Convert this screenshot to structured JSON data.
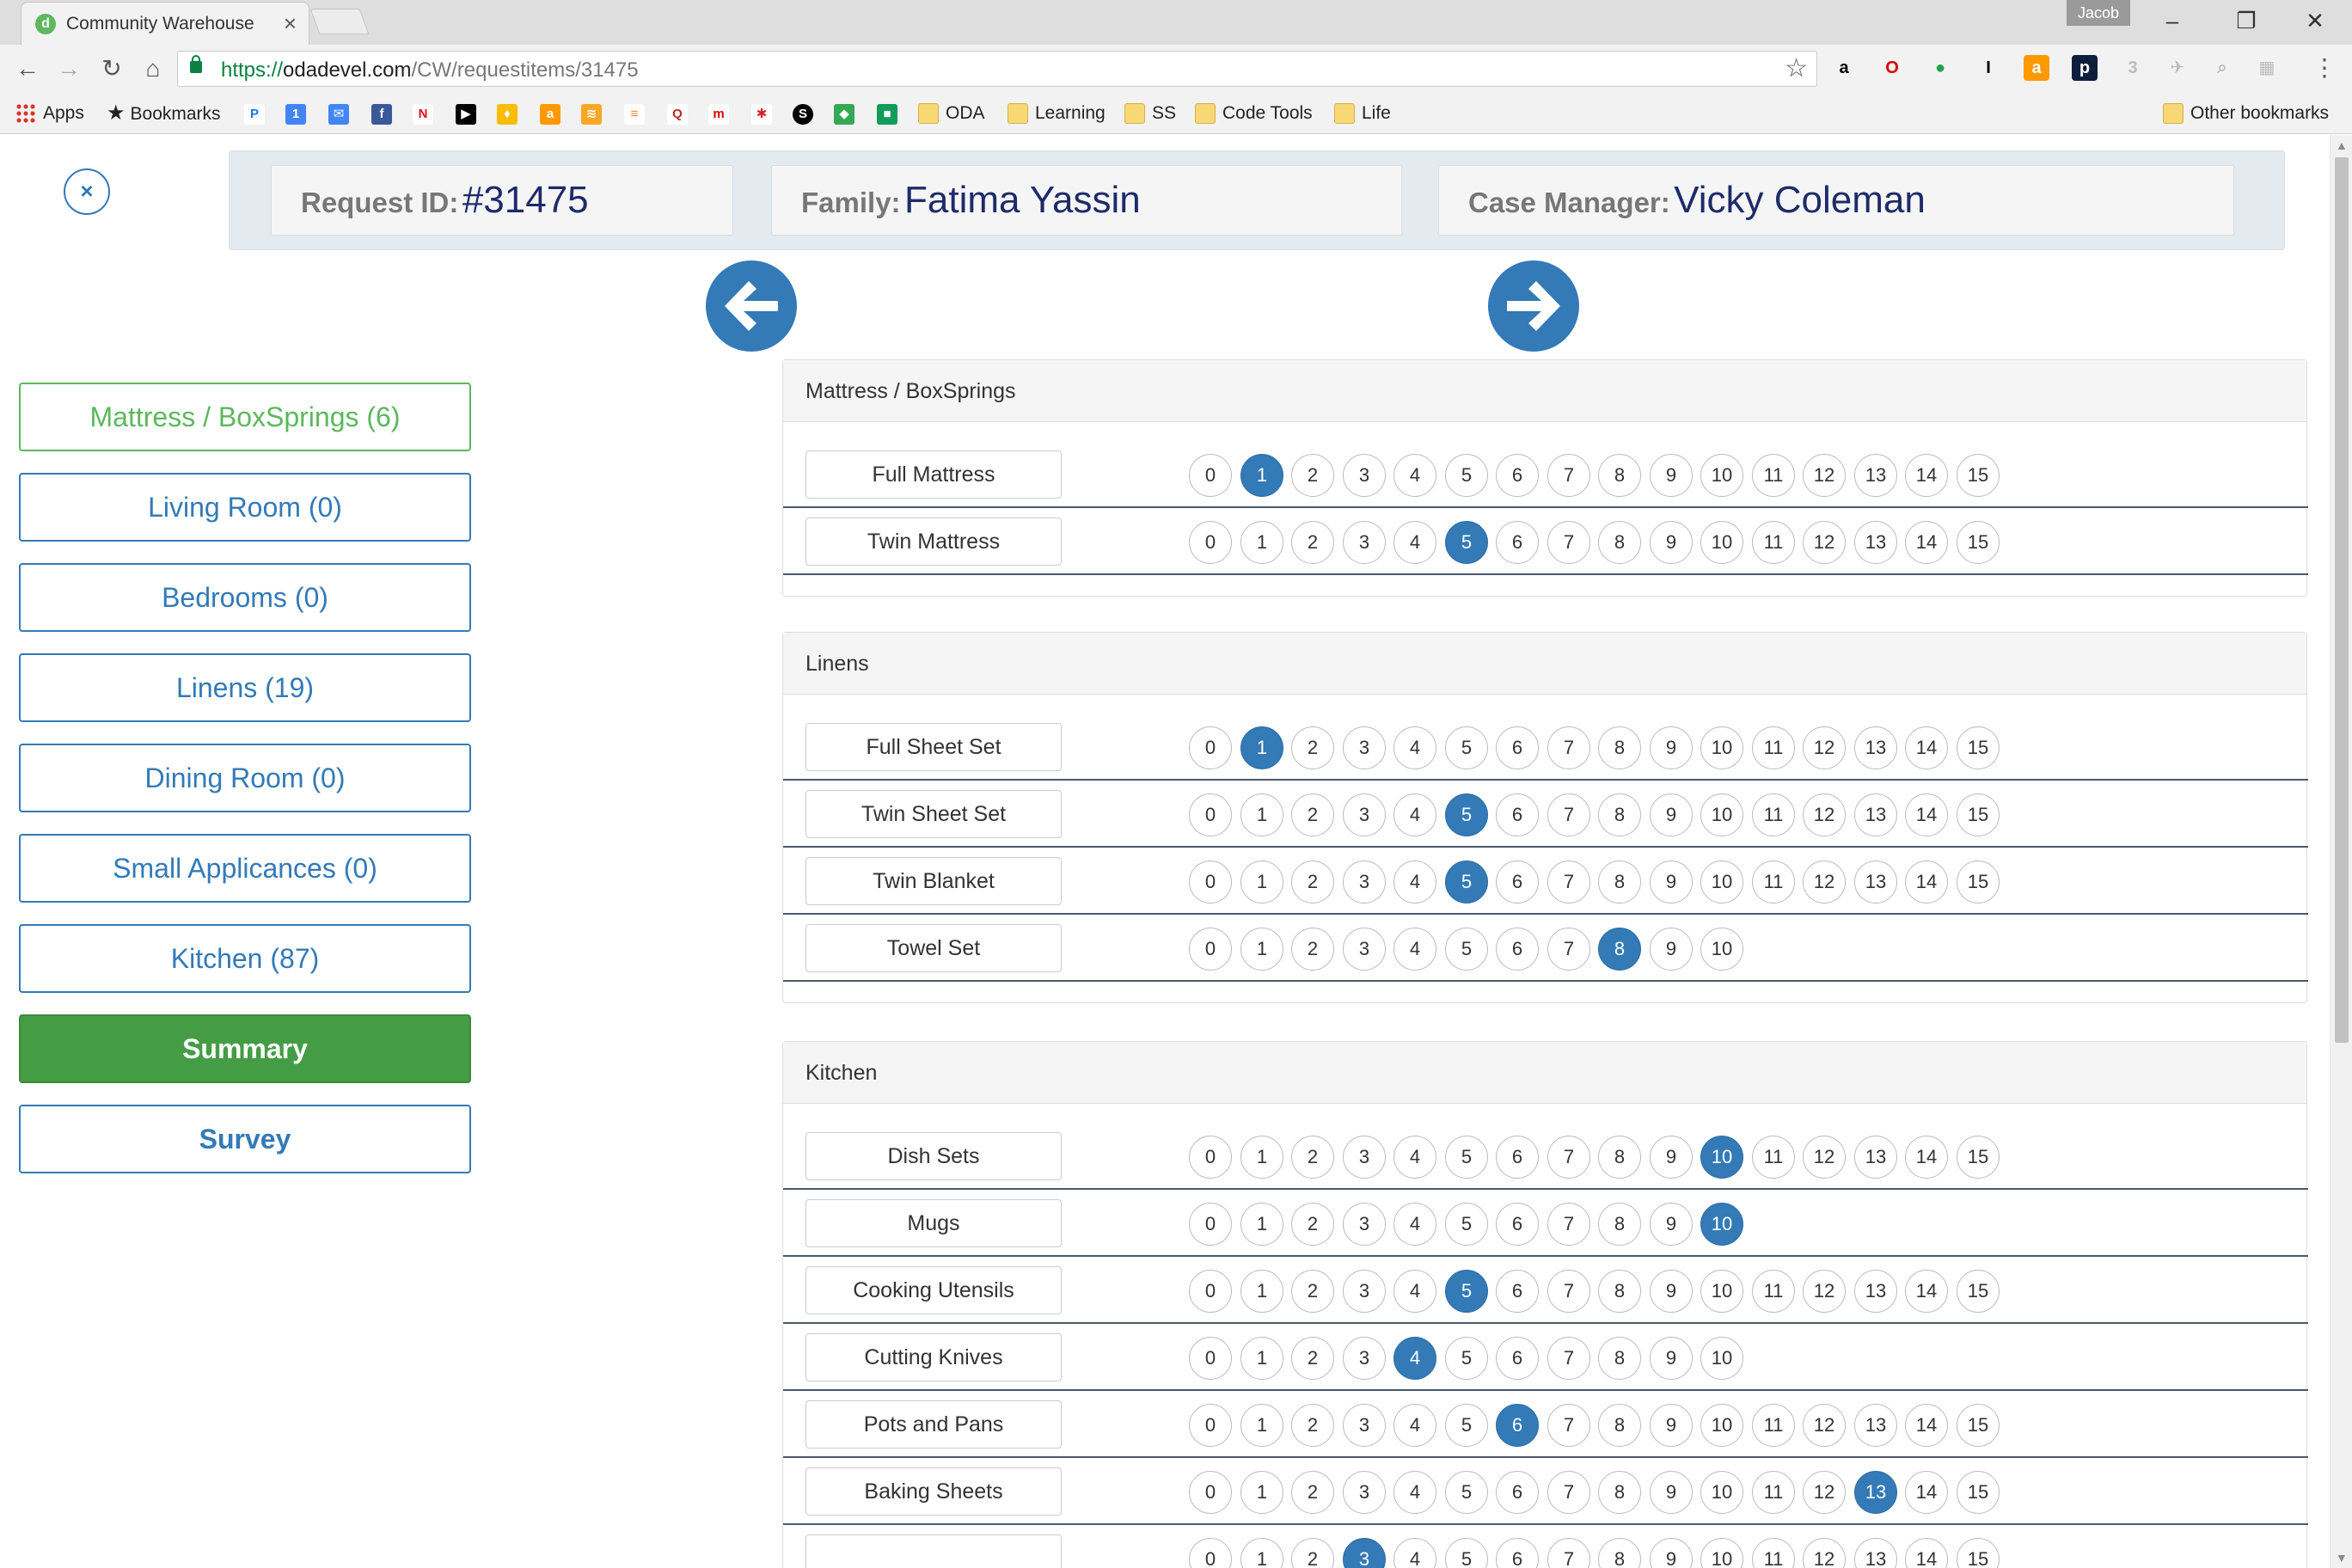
{
  "browser": {
    "tab_title": "Community Warehouse",
    "tab_close": "×",
    "profile_name": "Jacob",
    "url": {
      "scheme": "https://",
      "host": "odadevel.com",
      "path": "/CW/requestitems/31475"
    },
    "bookmarks": {
      "apps": "Apps",
      "bookmarks": "Bookmarks",
      "folders": [
        "ODA",
        "Learning",
        "SS",
        "Code Tools",
        "Life"
      ],
      "other": "Other bookmarks"
    }
  },
  "header": {
    "request_label": "Request ID:",
    "request_value": "#31475",
    "family_label": "Family:",
    "family_value": "Fatima Yassin",
    "manager_label": "Case Manager:",
    "manager_value": "Vicky Coleman"
  },
  "close_symbol": "×",
  "sidebar": {
    "items": [
      {
        "label": "Mattress / BoxSprings (6)",
        "style": "success"
      },
      {
        "label": "Living Room (0)",
        "style": "primary"
      },
      {
        "label": "Bedrooms (0)",
        "style": "primary"
      },
      {
        "label": "Linens (19)",
        "style": "primary"
      },
      {
        "label": "Dining Room (0)",
        "style": "primary"
      },
      {
        "label": "Small Applicances (0)",
        "style": "primary"
      },
      {
        "label": "Kitchen (87)",
        "style": "primary"
      },
      {
        "label": "Summary",
        "style": "active"
      },
      {
        "label": "Survey",
        "style": "bold"
      }
    ]
  },
  "categories": [
    {
      "title": "Mattress / BoxSprings",
      "items": [
        {
          "name": "Full Mattress",
          "max": 15,
          "selected": 1
        },
        {
          "name": "Twin Mattress",
          "max": 15,
          "selected": 5
        }
      ]
    },
    {
      "title": "Linens",
      "items": [
        {
          "name": "Full Sheet Set",
          "max": 15,
          "selected": 1
        },
        {
          "name": "Twin Sheet Set",
          "max": 15,
          "selected": 5
        },
        {
          "name": "Twin Blanket",
          "max": 15,
          "selected": 5
        },
        {
          "name": "Towel Set",
          "max": 10,
          "selected": 8
        }
      ]
    },
    {
      "title": "Kitchen",
      "items": [
        {
          "name": "Dish Sets",
          "max": 15,
          "selected": 10
        },
        {
          "name": "Mugs",
          "max": 10,
          "selected": 10
        },
        {
          "name": "Cooking Utensils",
          "max": 15,
          "selected": 5
        },
        {
          "name": "Cutting Knives",
          "max": 10,
          "selected": 4
        },
        {
          "name": "Pots and Pans",
          "max": 15,
          "selected": 6
        },
        {
          "name": "Baking Sheets",
          "max": 15,
          "selected": 13
        },
        {
          "name": "",
          "max": 15,
          "selected": 3
        }
      ]
    }
  ]
}
